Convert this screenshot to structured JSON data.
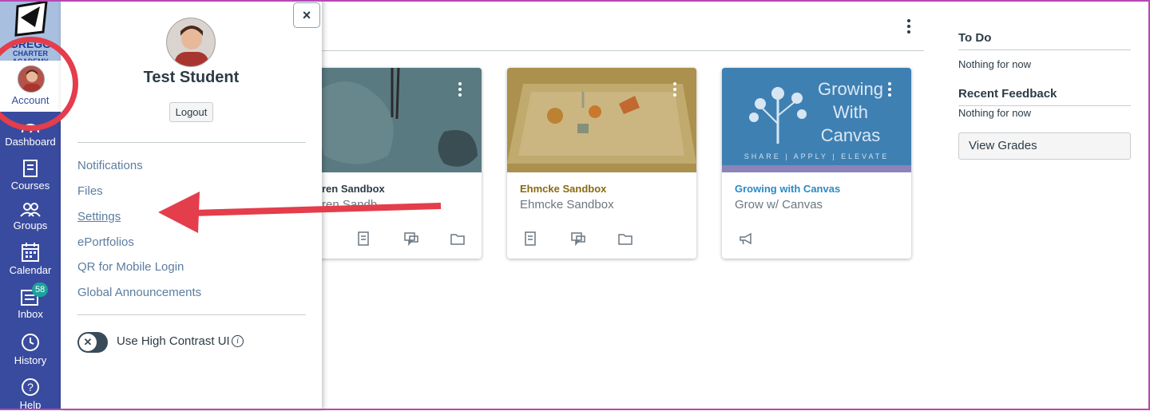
{
  "global_nav": {
    "logo_text": "CHARTER ACADEMY",
    "items": [
      {
        "label": "Account"
      },
      {
        "label": "Dashboard"
      },
      {
        "label": "Courses"
      },
      {
        "label": "Groups"
      },
      {
        "label": "Calendar"
      },
      {
        "label": "Inbox",
        "badge": "58"
      },
      {
        "label": "History"
      },
      {
        "label": "Help"
      }
    ]
  },
  "tray": {
    "close_label": "×",
    "user_name": "Test Student",
    "logout_label": "Logout",
    "links": [
      "Notifications",
      "Files",
      "Settings",
      "ePortfolios",
      "QR for Mobile Login",
      "Global Announcements"
    ],
    "high_contrast_label": "Use High Contrast UI",
    "toggle_glyph": "✕",
    "info_glyph": "i"
  },
  "cards": [
    {
      "title": "ren Sandbox",
      "subtitle": "ren Sandb",
      "title_color": "#2d3b45",
      "image_color": "#4f6f78"
    },
    {
      "title": "Ehmcke Sandbox",
      "subtitle": "Ehmcke Sandbox",
      "title_color": "#8a6a0f",
      "image_color": "#b39a55"
    },
    {
      "title": "Growing with Canvas",
      "subtitle": "Grow w/ Canvas",
      "title_color": "#2b8ac6",
      "image_color": "#3d7fb0",
      "image_text": [
        "Growing",
        "With",
        "Canvas"
      ],
      "image_footer": "SHARE | APPLY | ELEVATE"
    }
  ],
  "sidebar": {
    "todo_heading": "To Do",
    "todo_empty": "Nothing for now",
    "feedback_heading": "Recent Feedback",
    "feedback_empty": "Nothing for now",
    "view_grades_label": "View Grades"
  },
  "colors": {
    "nav_bg": "#394b9e",
    "annotation_red": "#e43d4b",
    "link": "#5c7da0"
  }
}
